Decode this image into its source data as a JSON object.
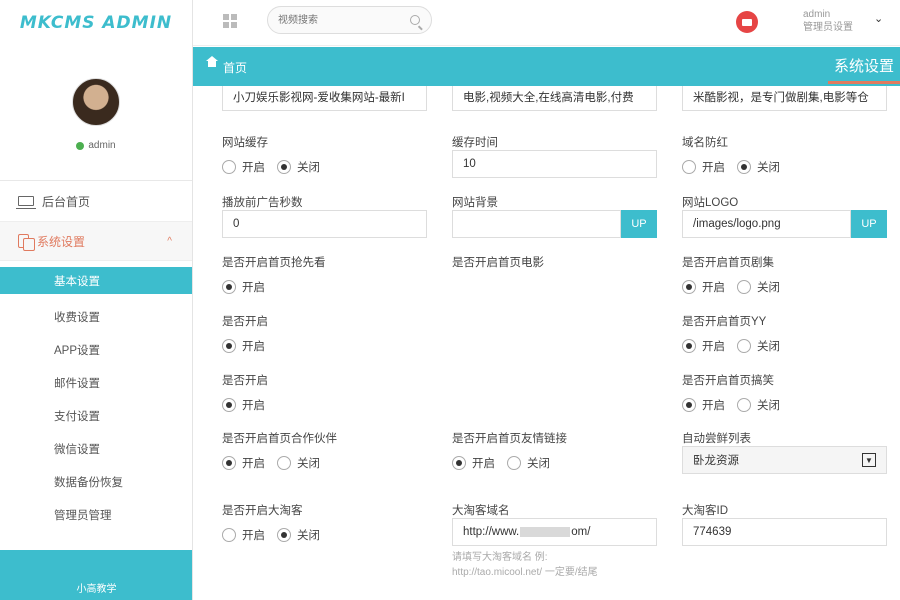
{
  "sidebar": {
    "logo": "MKCMS ADMIN",
    "user": "admin",
    "menu": [
      {
        "label": "后台首页",
        "icon": "monitor-icon"
      },
      {
        "label": "系统设置",
        "icon": "copy-icon",
        "chevron": "^"
      }
    ],
    "submenu": [
      "基本设置",
      "收费设置",
      "APP设置",
      "邮件设置",
      "支付设置",
      "微信设置",
      "数据备份恢复",
      "管理员管理"
    ],
    "footer": "小高教学"
  },
  "topbar": {
    "search_placeholder": "视频搜索",
    "user_name": "admin",
    "user_role": "管理员设置",
    "caret": "⌄"
  },
  "crumb": {
    "home": "首页",
    "section": "系统设置"
  },
  "form": {
    "top_inputs": [
      "小刀娱乐影视网-爱收集网站-最新I",
      "电影,视频大全,在线高清电影,付费",
      "米酷影视，是专门做剧集,电影等仓"
    ],
    "cache_label": "网站缓存",
    "cache_time_label": "缓存时间",
    "cache_time_value": "10",
    "domain_label": "域名防红",
    "ad_seconds_label": "播放前广告秒数",
    "ad_seconds_value": "0",
    "bg_label": "网站背景",
    "logo_label": "网站LOGO",
    "logo_value": "/images/logo.png",
    "up": "UP",
    "open": "开启",
    "close": "关闭",
    "home_first_label": "是否开启首页抢先看",
    "home_movie_label": "是否开启首页电影",
    "home_series_label": "是否开启首页剧集",
    "row2_left_label": "是否开启",
    "home_yy_label": "是否开启首页YY",
    "row3_left_label": "是否开启",
    "home_funny_label": "是否开启首页搞笑",
    "partner_label": "是否开启首页合作伙伴",
    "friendlink_label": "是否开启首页友情链接",
    "auto_list_label": "自动尝鲜列表",
    "auto_list_value": "卧龙资源",
    "taoke_label": "是否开启大淘客",
    "taoke_domain_label": "大淘客域名",
    "taoke_domain_value": "http://www.",
    "taoke_domain_tail": "om/",
    "taoke_id_label": "大淘客ID",
    "taoke_id_value": "774639",
    "hint_line1": "请填写大淘客域名 例:",
    "hint_line2": "http://tao.micool.net/ 一定要/结尾"
  }
}
